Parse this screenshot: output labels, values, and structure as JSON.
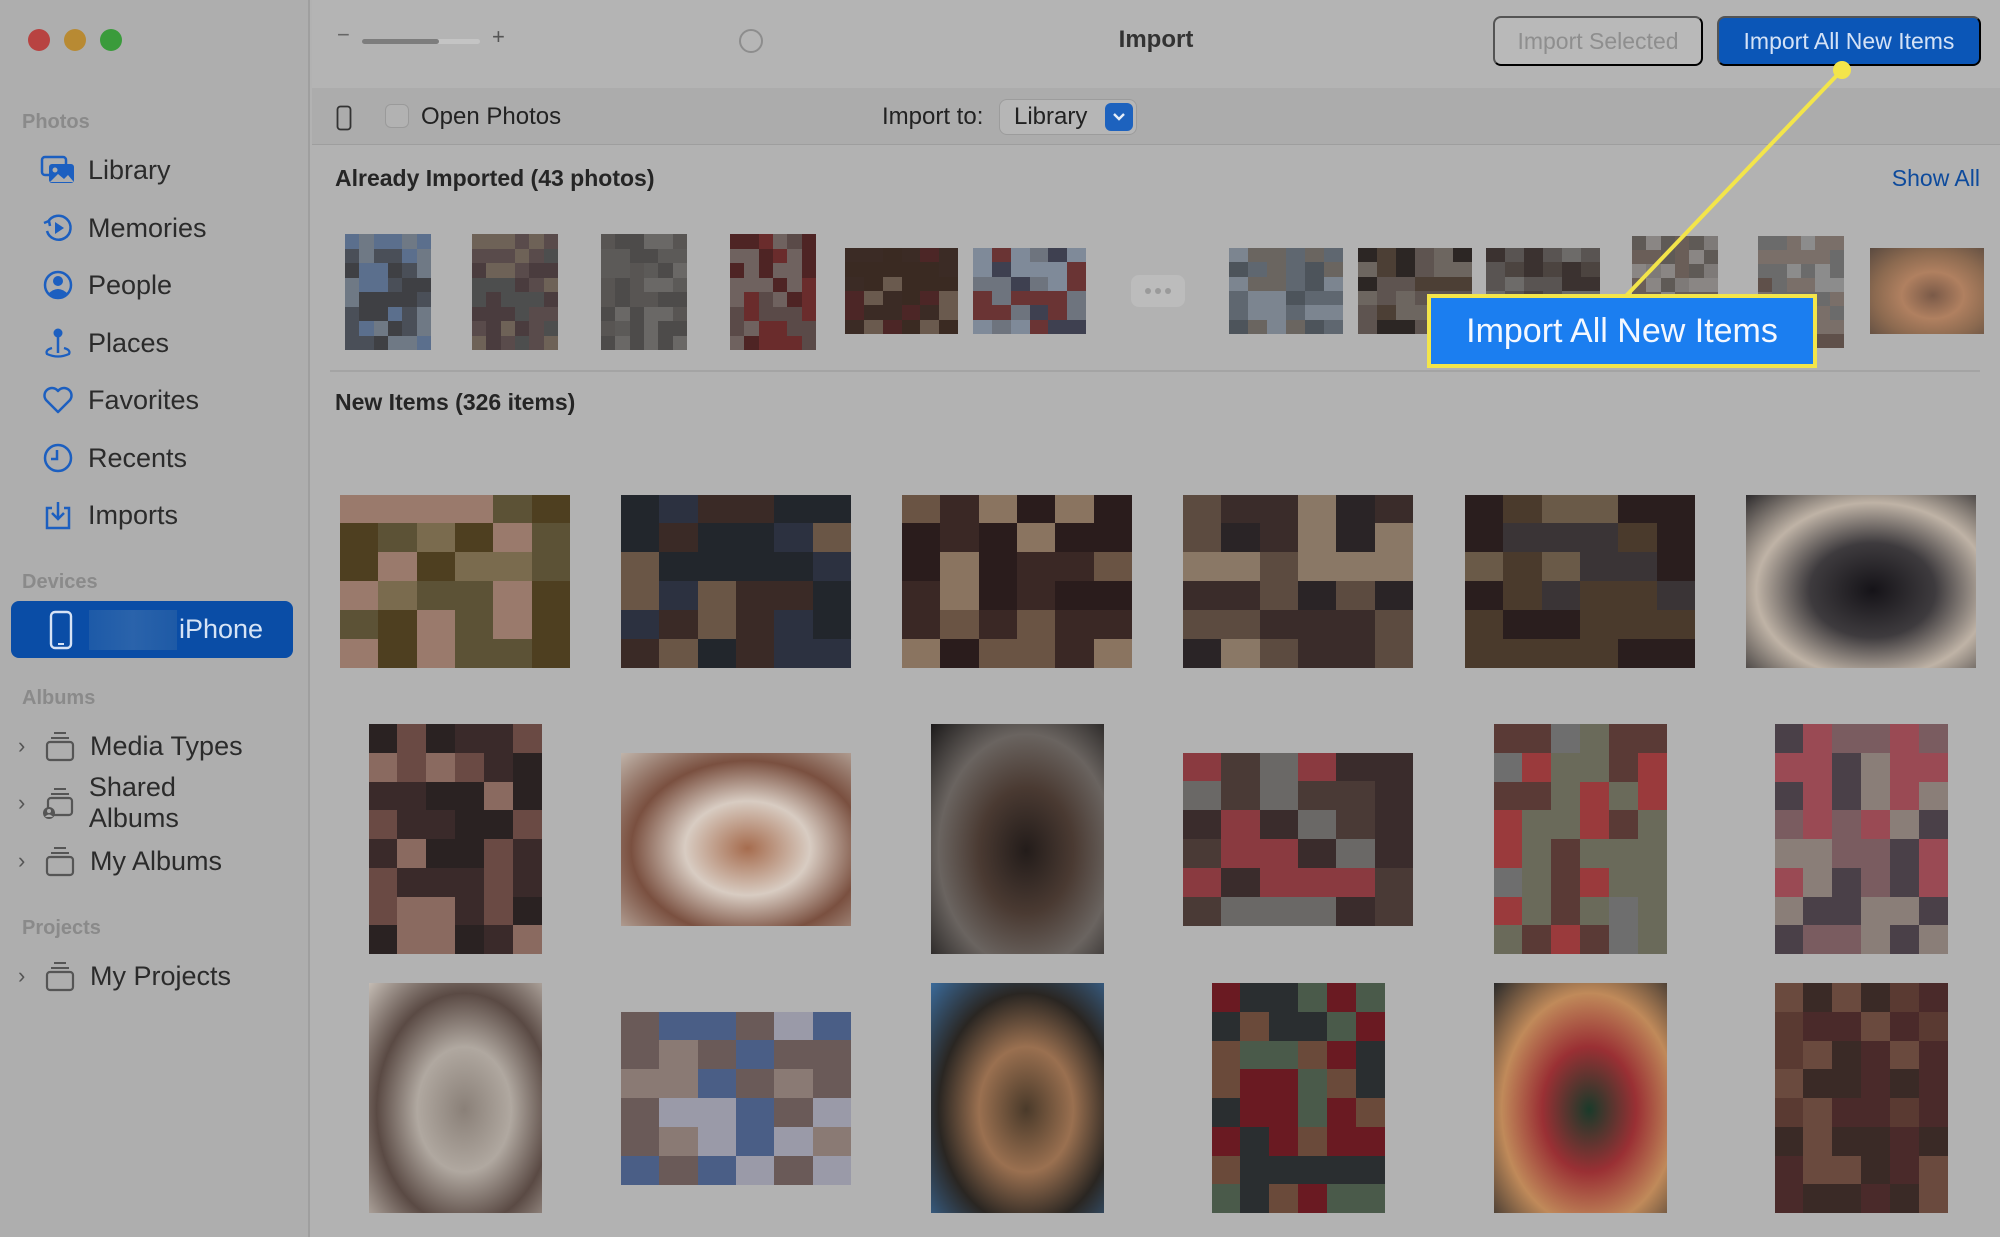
{
  "window": {
    "title": "Import",
    "traffic_lights": [
      "close",
      "minimize",
      "zoom"
    ]
  },
  "sidebar": {
    "sections": [
      {
        "label": "Photos",
        "items": [
          {
            "label": "Library",
            "icon": "library-icon"
          },
          {
            "label": "Memories",
            "icon": "memories-icon"
          },
          {
            "label": "People",
            "icon": "people-icon"
          },
          {
            "label": "Places",
            "icon": "places-icon"
          },
          {
            "label": "Favorites",
            "icon": "heart-icon"
          },
          {
            "label": "Recents",
            "icon": "clock-icon"
          },
          {
            "label": "Imports",
            "icon": "import-tray-icon"
          }
        ]
      },
      {
        "label": "Devices",
        "items": [
          {
            "label": "iPhone",
            "icon": "iphone-icon",
            "selected": true
          }
        ]
      },
      {
        "label": "Albums",
        "items": [
          {
            "label": "Media Types",
            "icon": "album-stack-icon",
            "expandable": true
          },
          {
            "label": "Shared Albums",
            "icon": "shared-album-icon",
            "expandable": true
          },
          {
            "label": "My Albums",
            "icon": "album-stack-icon",
            "expandable": true
          }
        ]
      },
      {
        "label": "Projects",
        "items": [
          {
            "label": "My Projects",
            "icon": "album-stack-icon",
            "expandable": true
          }
        ]
      }
    ]
  },
  "toolbar": {
    "zoom_minus": "−",
    "zoom_plus": "+",
    "zoom_level": 0.65,
    "import_selected_label": "Import Selected",
    "import_selected_enabled": false,
    "import_all_label": "Import All New Items"
  },
  "subbar": {
    "open_photos_label": "Open Photos",
    "open_photos_checked": false,
    "import_to_label": "Import to:",
    "import_to_value": "Library"
  },
  "already_imported": {
    "title": "Already Imported (43 photos)",
    "show_all_label": "Show All",
    "more_label": "•••",
    "thumbs_left": [
      {
        "palette": [
          "#6f7985",
          "#5b6f8d",
          "#4a4f58",
          "#3f4044"
        ],
        "orient": "portrait"
      },
      {
        "palette": [
          "#4d4e4e",
          "#6e6257",
          "#594b4b",
          "#4a3c3e"
        ],
        "orient": "portrait"
      },
      {
        "palette": [
          "#4d4b4a",
          "#6a6866",
          "#585553",
          "#5c5a58"
        ],
        "orient": "portrait"
      },
      {
        "palette": [
          "#6f625f",
          "#5a4a48",
          "#6a2c2c",
          "#4e2424"
        ],
        "orient": "portrait"
      },
      {
        "palette": [
          "#6a5a4e",
          "#3a2a22",
          "#4c2626",
          "#3b2b25"
        ],
        "orient": "landscape"
      },
      {
        "palette": [
          "#7f8a99",
          "#6e747e",
          "#3e4050",
          "#6a3434"
        ],
        "orient": "landscape"
      }
    ],
    "thumbs_right": [
      {
        "palette": [
          "#7c8590",
          "#5f6770",
          "#4d545b",
          "#6a6560"
        ],
        "orient": "landscape"
      },
      {
        "palette": [
          "#5e5450",
          "#2c2624",
          "#4c3f35",
          "#6d6660"
        ],
        "orient": "landscape"
      },
      {
        "palette": [
          "#6d6b69",
          "#3b3230",
          "#595452",
          "#4c4440"
        ],
        "orient": "landscape"
      },
      {
        "palette": [
          "#7e7a78",
          "#6a5e58",
          "#8a8684",
          "#5f5a56"
        ],
        "orient": "portrait"
      },
      {
        "palette": [
          "#7a6f69",
          "#5f504a",
          "#8c8c8c",
          "#6b6b6b"
        ],
        "orient": "portrait"
      },
      {
        "palette": [
          "#7a5a48",
          "#b08060",
          "#8c6a50",
          "#5a4a40"
        ],
        "orient": "landscape",
        "photo": "cat"
      }
    ]
  },
  "new_items": {
    "title": "New Items (326 items)",
    "rows": [
      [
        {
          "palette": [
            "#4e3f20",
            "#7a6b4e",
            "#9a7a6c",
            "#5c5236"
          ],
          "orient": "landscape"
        },
        {
          "palette": [
            "#3a2a26",
            "#6a5646",
            "#2c3140",
            "#22262c"
          ],
          "orient": "landscape"
        },
        {
          "palette": [
            "#6a5444",
            "#3a2825",
            "#2a1c1c",
            "#8a7460"
          ],
          "orient": "landscape"
        },
        {
          "palette": [
            "#5c4b40",
            "#3a2c2a",
            "#2a2426",
            "#8a7866"
          ],
          "orient": "landscape"
        },
        {
          "palette": [
            "#4a3a2c",
            "#2a1e1e",
            "#6a5a48",
            "#3a3436"
          ],
          "orient": "landscape"
        },
        {
          "palette": [
            "#151318",
            "#3e3b3e",
            "#bfb3a6",
            "#2c2a2c"
          ],
          "orient": "landscape",
          "photo": "gray-cat"
        }
      ],
      [
        {
          "palette": [
            "#3a2a2a",
            "#6a4a44",
            "#8a6a60",
            "#2a2222"
          ],
          "orient": "portrait"
        },
        {
          "palette": [
            "#a66c4e",
            "#d8ccc2",
            "#7a5040",
            "#c0b4aa"
          ],
          "orient": "landscape",
          "photo": "orange-cat"
        },
        {
          "palette": [
            "#231c1a",
            "#4a3a32",
            "#6a6460",
            "#1c1a1a"
          ],
          "orient": "portrait",
          "photo": "cats-window"
        },
        {
          "palette": [
            "#4a3a36",
            "#8a3a40",
            "#6a6866",
            "#3a2c2c"
          ],
          "orient": "landscape"
        },
        {
          "palette": [
            "#6a6a5a",
            "#9a3a3c",
            "#5a3a36",
            "#6e6e6e"
          ],
          "orient": "portrait"
        },
        {
          "palette": [
            "#8a7e78",
            "#7a5c60",
            "#9a4a54",
            "#4a4048"
          ],
          "orient": "portrait"
        }
      ],
      [
        {
          "palette": [
            "#8a8078",
            "#b0a8a0",
            "#5a4a44",
            "#c4bcb4"
          ],
          "orient": "portrait",
          "photo": "white-dog"
        },
        {
          "palette": [
            "#9a9aa8",
            "#6a5a58",
            "#4a5e86",
            "#8a7a74"
          ],
          "orient": "landscape"
        },
        {
          "palette": [
            "#4a3a2a",
            "#9a7050",
            "#2a2622",
            "#3a6a9a"
          ],
          "orient": "portrait",
          "photo": "cat-on-lap"
        },
        {
          "palette": [
            "#4a5a4a",
            "#6a4a3a",
            "#2a2e30",
            "#6a1a22"
          ],
          "orient": "portrait"
        },
        {
          "palette": [
            "#1a3a2a",
            "#9a3034",
            "#c08a5a",
            "#2a2a2a"
          ],
          "orient": "portrait",
          "photo": "cat-with-gift"
        },
        {
          "palette": [
            "#3a2a26",
            "#6a4a3e",
            "#5a3a32",
            "#4a2a2a"
          ],
          "orient": "portrait"
        }
      ]
    ]
  },
  "callout": {
    "label": "Import All New Items",
    "border_color": "#f3e54a",
    "fill_color": "#1b7ef0"
  },
  "colors": {
    "accent": "#0b56b7",
    "selection": "#0a4da6",
    "link": "#0d4a9c",
    "sidebar_icon": "#1c5fc0"
  }
}
